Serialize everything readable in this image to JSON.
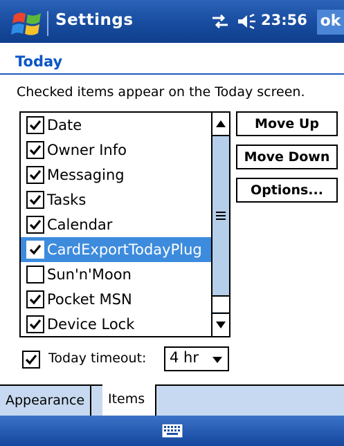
{
  "titlebar": {
    "title": "Settings",
    "clock": "23:56",
    "ok_label": "ok",
    "icons": [
      "windows-start-icon",
      "connectivity-icon",
      "volume-icon"
    ]
  },
  "page": {
    "title": "Today",
    "instructions": "Checked items appear on the Today screen."
  },
  "list": {
    "items": [
      {
        "label": "Date",
        "checked": true,
        "selected": false
      },
      {
        "label": "Owner Info",
        "checked": true,
        "selected": false
      },
      {
        "label": "Messaging",
        "checked": true,
        "selected": false
      },
      {
        "label": "Tasks",
        "checked": true,
        "selected": false
      },
      {
        "label": "Calendar",
        "checked": true,
        "selected": false
      },
      {
        "label": "CardExportTodayPlug",
        "checked": true,
        "selected": true
      },
      {
        "label": "Sun'n'Moon",
        "checked": false,
        "selected": false
      },
      {
        "label": "Pocket MSN",
        "checked": true,
        "selected": false
      },
      {
        "label": "Device Lock",
        "checked": true,
        "selected": false
      }
    ]
  },
  "buttons": {
    "move_up": "Move Up",
    "move_down": "Move Down",
    "options": "Options..."
  },
  "timeout": {
    "label": "Today timeout:",
    "checked": true,
    "value": "4 hr"
  },
  "tabs": [
    {
      "label": "Appearance",
      "active": false
    },
    {
      "label": "Items",
      "active": true
    }
  ],
  "colors": {
    "titlebar": "#1a4fa3",
    "heading": "#0b55c8",
    "selection": "#3d8bdd",
    "tabstrip": "#c7d9f0"
  }
}
